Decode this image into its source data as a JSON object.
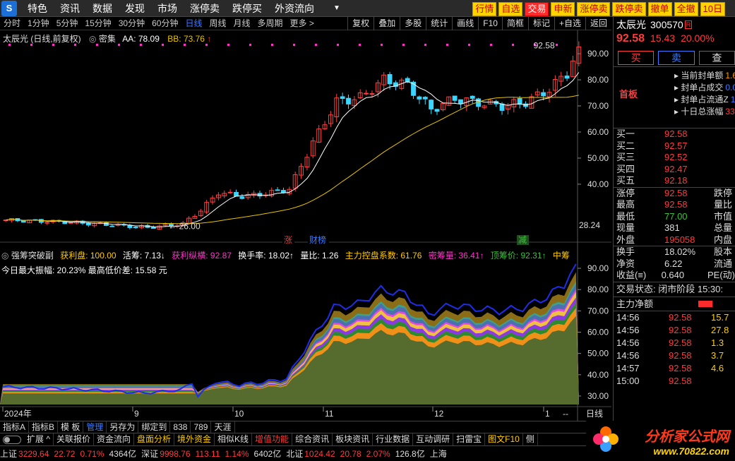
{
  "menubar": {
    "logo": "S",
    "items": [
      "特色",
      "资讯",
      "数据",
      "发现",
      "市场",
      "涨停卖",
      "跌停买",
      "外资流向"
    ],
    "quick_buttons": [
      "行情",
      "自选",
      "交易",
      "申新",
      "涨停卖",
      "跌停卖",
      "撤单",
      "全撤",
      "10日"
    ],
    "active_quick": "交易"
  },
  "periodbar": {
    "periods": [
      "分时",
      "1分钟",
      "5分钟",
      "15分钟",
      "30分钟",
      "60分钟",
      "日线",
      "周线",
      "月线",
      "多周期",
      "更多 >"
    ],
    "active": "日线",
    "tools": [
      "复权",
      "叠加",
      "多股",
      "统计",
      "画线",
      "F10",
      "简框",
      "标记",
      "+自选",
      "返回"
    ]
  },
  "main_chart": {
    "legend": {
      "title": "太辰光 (日线,前复权)",
      "tag": "密集",
      "aa_label": "AA: 78.09",
      "bb_label": "BB: 73.76",
      "aa_color": "#ffffff",
      "bb_color": "#e8c300"
    },
    "annotations": {
      "high_label": "92.58",
      "low_label": "← 26.00",
      "last_ma": "28.24"
    },
    "markers": [
      "涨",
      "财榜",
      "减"
    ]
  },
  "chart_data": [
    {
      "type": "candlestick",
      "title": "太辰光 (日线,前复权)",
      "y_ticks": [
        40.0,
        50.0,
        60.0,
        70.0,
        80.0,
        90.0
      ],
      "ylim": [
        20.5,
        93
      ],
      "x_ticks": [
        "2024年",
        "9",
        "10",
        "11",
        "12",
        "1"
      ],
      "series_lines": [
        {
          "name": "AA",
          "value_last": 78.09,
          "color": "#ffffff"
        },
        {
          "name": "BB",
          "value_last": 73.76,
          "color": "#e8c300"
        }
      ],
      "price_range": {
        "low": 26.0,
        "high": 92.58
      }
    },
    {
      "type": "area",
      "title": "强筹突破副",
      "y_ticks": [
        30.0,
        40.0,
        50.0,
        60.0,
        70.0,
        80.0,
        90.0
      ],
      "ylim": [
        26,
        93
      ],
      "stats": [
        {
          "label": "获利盘",
          "value": "100.00"
        },
        {
          "label": "活筹",
          "value": "7.13"
        },
        {
          "label": "获利纵横",
          "value": "92.87"
        },
        {
          "label": "换手率",
          "value": "18.02"
        },
        {
          "label": "量比",
          "value": "1.26"
        },
        {
          "label": "主力控盘系数",
          "value": "61.76"
        },
        {
          "label": "密筹量",
          "value": "36.41"
        },
        {
          "label": "顶筹价",
          "value": "92.31"
        },
        {
          "label": "中筹",
          "value": ""
        }
      ],
      "note": "今日最大振幅: 20.23% 最高低价差: 15.58 元"
    }
  ],
  "sub_chart": {
    "title": "强筹突破副",
    "stats": [
      {
        "label": "获利盘:",
        "value": "100.00",
        "color": "#ffcc00"
      },
      {
        "label": "活筹:",
        "value": "7.13↓",
        "color": "#ffffff"
      },
      {
        "label": "获利纵横:",
        "value": "92.87",
        "color": "#ff33cc"
      },
      {
        "label": "换手率:",
        "value": "18.02↑",
        "color": "#ffffff"
      },
      {
        "label": "量比:",
        "value": "1.26",
        "color": "#ffffff"
      },
      {
        "label": "主力控盘系数:",
        "value": "61.76",
        "color": "#ffcc00"
      },
      {
        "label": "密筹量:",
        "value": "36.41↑",
        "color": "#ff33cc"
      },
      {
        "label": "顶筹价:",
        "value": "92.31↑",
        "color": "#39c339"
      },
      {
        "label": "中筹",
        "value": "",
        "color": "#ffcc00"
      }
    ],
    "note": "今日最大振幅: 20.23% 最高低价差: 15.58 元"
  },
  "xaxis": {
    "labels": [
      "2024年",
      "9",
      "10",
      "11",
      "12",
      "1"
    ],
    "right_label": "日线",
    "dash": "--"
  },
  "rightpanel": {
    "name": "太辰光",
    "code": "300570",
    "tag": "R",
    "price": "92.58",
    "change": "15.43",
    "pct": "20.00%",
    "buttons": {
      "buy": "买",
      "sell": "卖",
      "query": "查"
    },
    "seal_label": "首板",
    "seal_rows": [
      {
        "k": "当前封单额",
        "v": "1.6",
        "c": ""
      },
      {
        "k": "封单占成交",
        "v": "0.0",
        "c": "blue"
      },
      {
        "k": "封单占流通Z",
        "v": "1.0",
        "c": "blue"
      },
      {
        "k": "十日总涨幅",
        "v": "33.",
        "c": "red"
      }
    ],
    "book": [
      {
        "k": "买一",
        "v": "92.58"
      },
      {
        "k": "买二",
        "v": "92.57"
      },
      {
        "k": "买三",
        "v": "92.52"
      },
      {
        "k": "买四",
        "v": "92.47"
      },
      {
        "k": "买五",
        "v": "92.18"
      }
    ],
    "quote_rows": [
      {
        "k": "涨停",
        "v": "92.58",
        "c": "",
        "k2": "跌停"
      },
      {
        "k": "最高",
        "v": "92.58",
        "c": "",
        "k2": "量比"
      },
      {
        "k": "最低",
        "v": "77.00",
        "c": "g",
        "k2": "市值"
      },
      {
        "k": "现量",
        "v": "381",
        "c": "w",
        "k2": "总量"
      },
      {
        "k": "外盘",
        "v": "195058",
        "c": "",
        "k2": "内盘"
      }
    ],
    "stat_rows": [
      {
        "k": "换手",
        "v": "18.02%",
        "k2": "股本"
      },
      {
        "k": "净资",
        "v": "6.22",
        "k2": "流通"
      },
      {
        "k": "收益(≡)",
        "v": "0.640",
        "k2": "PE(动)"
      }
    ],
    "status": "交易状态: 闭市阶段 15:30:",
    "flow_label": "主力净额",
    "ticks": [
      {
        "t": "14:56",
        "p": "92.58",
        "q": "15.7"
      },
      {
        "t": "14:56",
        "p": "92.58",
        "q": "27.8"
      },
      {
        "t": "14:56",
        "p": "92.58",
        "q": "1.3"
      },
      {
        "t": "14:56",
        "p": "92.58",
        "q": "3.7"
      },
      {
        "t": "14:57",
        "p": "92.58",
        "q": "4.6"
      },
      {
        "t": "15:00",
        "p": "92.58",
        "q": ""
      }
    ]
  },
  "tabbar": {
    "items": [
      "指标A",
      "指标B",
      "模 板",
      "管理",
      "另存为",
      "绑定到",
      "838",
      "789",
      "天涯"
    ],
    "active": "管理"
  },
  "toolbar2": {
    "items": [
      "扩展 ^",
      "关联报价",
      "资金流向",
      "盘面分析",
      "境外资金",
      "相似K线",
      "增值功能",
      "综合资讯",
      "板块资讯",
      "行业数据",
      "互动调研",
      "扫雷宝",
      "图文F10",
      "侧"
    ]
  },
  "indexbar": {
    "items": [
      {
        "name": "上证",
        "val": "3229.64",
        "chg": "22.72",
        "pct": "0.71%",
        "amt": "4364亿"
      },
      {
        "name": "深证",
        "val": "9998.76",
        "chg": "113.11",
        "pct": "1.14%",
        "amt": "6402亿"
      },
      {
        "name": "北证",
        "val": "1024.42",
        "chg": "20.78",
        "pct": "2.07%",
        "amt": "126.8亿"
      }
    ],
    "tail": "上海"
  },
  "brand": {
    "name": "分析家公式网",
    "url": "www.70822.com"
  },
  "watermark": "分析家公式网 www.70822.com"
}
